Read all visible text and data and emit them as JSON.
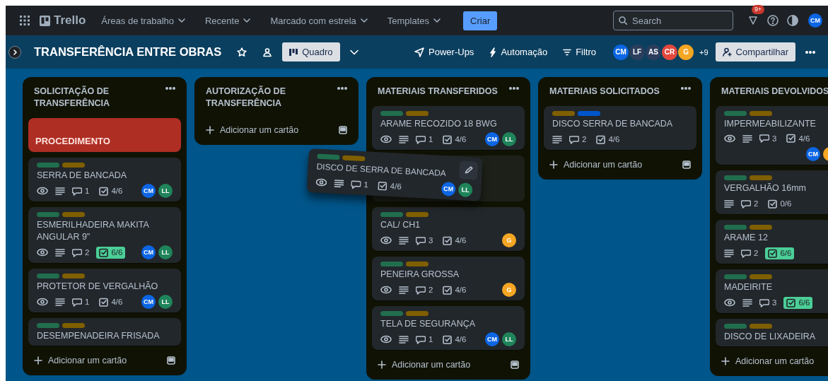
{
  "header": {
    "app_name": "Trello",
    "nav": [
      {
        "label": "Áreas de trabalho"
      },
      {
        "label": "Recente"
      },
      {
        "label": "Marcado com estrela"
      },
      {
        "label": "Templates"
      }
    ],
    "create": "Criar",
    "search": {
      "placeholder": "Search"
    },
    "notifications": "9+",
    "account": {
      "initials": "CM",
      "color": "#0c66e4"
    }
  },
  "board": {
    "title": "TRANSFERÊNCIA ENTRE OBRAS",
    "view": "Quadro",
    "power_ups": "Power-Ups",
    "automation": "Automação",
    "filter": "Filtro",
    "members": [
      {
        "initials": "CM",
        "color": "#0c66e4"
      },
      {
        "initials": "LF",
        "color": "#2c3e5d"
      },
      {
        "initials": "AS",
        "color": "#2c3e5d"
      },
      {
        "initials": "CR",
        "color": "#e2483d"
      },
      {
        "initials": "G",
        "color": "#f5a623"
      }
    ],
    "more_members": "+9",
    "share": "Compartilhar"
  },
  "lists": [
    {
      "title": "SOLICITAÇÃO DE TRANSFERÊNCIA",
      "menu": true,
      "template": true,
      "add": "Adicionar um cartão",
      "cards": [
        {
          "kind": "cover",
          "title": "PROCEDIMENTO"
        },
        {
          "kind": "card",
          "labels": [
            {
              "color": "#216e4e"
            },
            {
              "color": "#7f5f01"
            }
          ],
          "title": "SERRA DE BANCADA",
          "watching": true,
          "description": true,
          "comments": "1",
          "checklist": "4/6",
          "checklist_complete": false,
          "members": [
            {
              "initials": "CM",
              "color": "#0c66e4"
            },
            {
              "initials": "LL",
              "color": "#1f845a"
            }
          ]
        },
        {
          "kind": "card",
          "labels": [
            {
              "color": "#216e4e"
            },
            {
              "color": "#7f5f01"
            }
          ],
          "title": "ESMERILHADEIRA MAKITA ANGULAR 9\"",
          "watching": true,
          "description": true,
          "comments": "2",
          "checklist": "6/6",
          "checklist_complete": true,
          "members": [
            {
              "initials": "CM",
              "color": "#0c66e4"
            },
            {
              "initials": "LL",
              "color": "#1f845a"
            }
          ]
        },
        {
          "kind": "card",
          "labels": [
            {
              "color": "#216e4e"
            },
            {
              "color": "#7f5f01"
            }
          ],
          "title": "PROTETOR DE VERGALHÃO",
          "watching": true,
          "description": true,
          "comments": "1",
          "checklist": "4/6",
          "checklist_complete": false,
          "members": [
            {
              "initials": "CM",
              "color": "#0c66e4"
            },
            {
              "initials": "LL",
              "color": "#1f845a"
            }
          ]
        },
        {
          "kind": "card",
          "labels": [
            {
              "color": "#216e4e"
            },
            {
              "color": "#7f5f01"
            }
          ],
          "title": "DESEMPENADEIRA FRISADA"
        }
      ]
    },
    {
      "title": "AUTORIZAÇÃO DE TRANSFERÊNCIA",
      "menu": true,
      "template": true,
      "add": "Adicionar um cartão"
    },
    {
      "title": "MATERIAIS TRANSFERIDOS",
      "menu": true,
      "template": true,
      "add": "Adicionar um cartão",
      "cards": [
        {
          "kind": "card",
          "labels": [
            {
              "color": "#216e4e"
            },
            {
              "color": "#7f5f01"
            }
          ],
          "title": "ARAME RECOZIDO 18 BWG",
          "watching": true,
          "description": true,
          "comments": "1",
          "checklist": "4/6",
          "checklist_complete": false,
          "members": [
            {
              "initials": "CM",
              "color": "#0c66e4"
            },
            {
              "initials": "LL",
              "color": "#1f845a"
            }
          ]
        },
        {
          "kind": "placeholder"
        },
        {
          "kind": "card",
          "labels": [
            {
              "color": "#216e4e"
            },
            {
              "color": "#7f5f01"
            }
          ],
          "title": "CAL/ CH1",
          "watching": true,
          "description": true,
          "comments": "3",
          "checklist": "4/6",
          "checklist_complete": false,
          "members": [
            {
              "initials": "G",
              "color": "#f5a623"
            }
          ]
        },
        {
          "kind": "card",
          "labels": [
            {
              "color": "#216e4e"
            },
            {
              "color": "#7f5f01"
            }
          ],
          "title": "PENEIRA GROSSA",
          "watching": true,
          "description": true,
          "comments": "2",
          "checklist": "4/6",
          "checklist_complete": false,
          "members": [
            {
              "initials": "G",
              "color": "#f5a623"
            }
          ]
        },
        {
          "kind": "card",
          "labels": [
            {
              "color": "#216e4e"
            },
            {
              "color": "#7f5f01"
            }
          ],
          "title": "TELA DE SEGURANÇA",
          "watching": true,
          "description": true,
          "comments": "1",
          "checklist": "4/6",
          "checklist_complete": false,
          "members": [
            {
              "initials": "CM",
              "color": "#0c66e4"
            },
            {
              "initials": "LL",
              "color": "#1f845a"
            }
          ]
        }
      ]
    },
    {
      "title": "MATERIAIS SOLICITADOS",
      "menu": true,
      "template": true,
      "add": "Adicionar um cartão",
      "cards": [
        {
          "kind": "card",
          "labels": [
            {
              "color": "#7f5f01"
            },
            {
              "color": "#0055cc"
            }
          ],
          "title": "DISCO SERRA DE BANCADA",
          "watching": false,
          "description": true,
          "comments": "2",
          "checklist": "4/6",
          "checklist_complete": false
        }
      ]
    },
    {
      "title": "MATERIAIS DEVOLVIDOS",
      "menu": false,
      "template": false,
      "add": "Adicionar um cartão",
      "cards": [
        {
          "kind": "card",
          "labels": [
            {
              "color": "#216e4e"
            },
            {
              "color": "#7f5f01"
            }
          ],
          "title": "IMPERMEABILIZANTE",
          "watching": true,
          "description": true,
          "comments": "3",
          "checklist": "4/6",
          "checklist_complete": false,
          "members": [
            {
              "initials": "CM",
              "color": "#0c66e4"
            },
            {
              "color": "#f5a623"
            }
          ]
        },
        {
          "kind": "card",
          "labels": [
            {
              "color": "#216e4e"
            },
            {
              "color": "#7f5f01"
            }
          ],
          "title": "VERGALHÃO 16mm",
          "watching": false,
          "description": true,
          "comments": "2",
          "checklist": "0/6",
          "checklist_complete": false
        },
        {
          "kind": "card",
          "labels": [
            {
              "color": "#216e4e"
            },
            {
              "color": "#7f5f01"
            }
          ],
          "title": "ARAME 12",
          "watching": false,
          "description": true,
          "comments": "2",
          "checklist": "6/6",
          "checklist_complete": true
        },
        {
          "kind": "card",
          "labels": [
            {
              "color": "#216e4e"
            },
            {
              "color": "#7f5f01"
            }
          ],
          "title": "MADEIRITE",
          "watching": true,
          "description": true,
          "comments": "3",
          "checklist": "6/6",
          "checklist_complete": true
        },
        {
          "kind": "card",
          "labels": [
            {
              "color": "#216e4e"
            },
            {
              "color": "#7f5f01"
            }
          ],
          "title": "DISCO DE LIXADEIRA"
        }
      ]
    }
  ],
  "dragged_card": {
    "labels": [
      {
        "color": "#216e4e"
      },
      {
        "color": "#7f5f01"
      }
    ],
    "title": "DISCO DE SERRA DE BANCADA",
    "watching": true,
    "description": true,
    "comments": "1",
    "checklist": "4/6",
    "checklist_complete": false,
    "members": [
      {
        "initials": "CM",
        "color": "#0c66e4"
      },
      {
        "initials": "LL",
        "color": "#1f845a"
      }
    ]
  }
}
